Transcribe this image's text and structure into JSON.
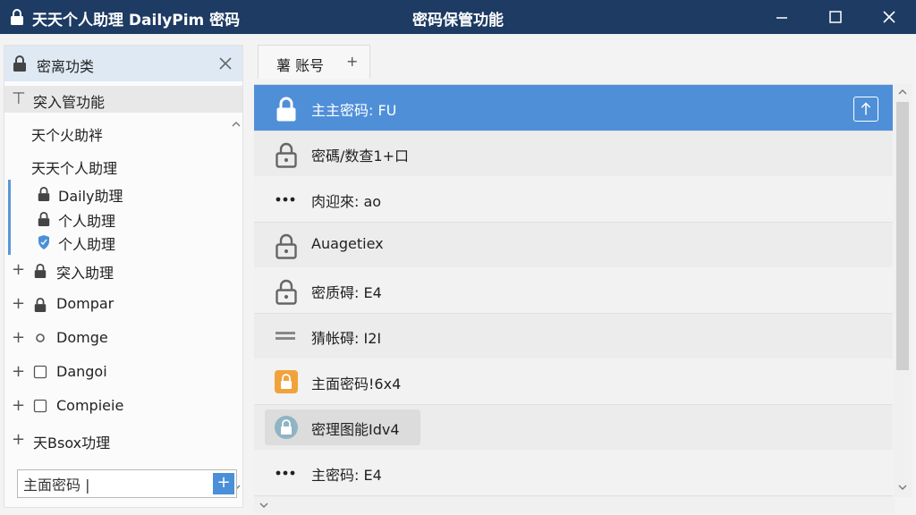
{
  "titlebar": {
    "app_title": "天天个人助理 DailyPim 密码",
    "window_title": "密码保管功能",
    "icon": "lock-icon"
  },
  "sidebar": {
    "header": "密离功类",
    "search": {
      "value": "主面密码 |",
      "add_label": "+"
    },
    "tree": [
      {
        "label": "突入管功能",
        "toggle": "⊤",
        "icon": "none",
        "selected": true
      },
      {
        "label": "天个火助袢",
        "icon": "none"
      },
      {
        "label": "天天个人助理",
        "icon": "none"
      },
      {
        "label": "Daily助理",
        "icon": "lock-icon",
        "sub": true
      },
      {
        "label": "个人助理",
        "icon": "lock-icon",
        "sub": true
      },
      {
        "label": "个人助理",
        "icon": "shield-icon",
        "sub": true
      },
      {
        "label": "突入助理",
        "toggle": "+",
        "icon": "lock-icon"
      },
      {
        "label": "Dompar",
        "toggle": "+",
        "icon": "lock-icon"
      },
      {
        "label": "Domge",
        "toggle": "+",
        "icon": "circle-icon"
      },
      {
        "label": "Dangoi",
        "toggle": "+",
        "icon": "checkbox-icon"
      },
      {
        "label": "Compieie",
        "toggle": "+",
        "icon": "checkbox-icon"
      },
      {
        "label": "天Bsox功理",
        "toggle": "+",
        "icon": "none"
      }
    ]
  },
  "tab": {
    "label": "薯 账号",
    "add": "+"
  },
  "list": [
    {
      "label": "主主密码: FU",
      "icon": "lock-icon",
      "selected": true
    },
    {
      "label": "密碼/数查1+口",
      "icon": "lock-outline-icon"
    },
    {
      "label": "肉迎來: ao",
      "icon": "dots-icon"
    },
    {
      "label": "Auagetiex",
      "icon": "lock-outline-icon"
    },
    {
      "label": "密质碍: E4",
      "icon": "lock-outline-icon"
    },
    {
      "label": "猜帐碍: I2I",
      "icon": "card-icon"
    },
    {
      "label": "主面密码!6x4",
      "icon": "orange-lock-icon"
    },
    {
      "label": "密理图能Idv4",
      "icon": "teal-lock-icon",
      "hover": true
    },
    {
      "label": "主密码: E4",
      "icon": "dots-icon"
    }
  ],
  "colors": {
    "titlebar": "#1d3b63",
    "accent": "#4f8fd8",
    "orange": "#f0a33a"
  }
}
